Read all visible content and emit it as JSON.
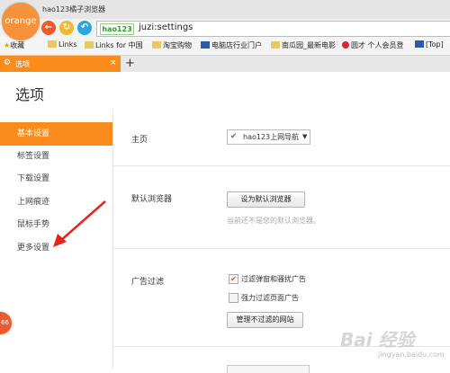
{
  "window": {
    "title": "hao123橘子浏览器",
    "logo_text": "orange"
  },
  "nav": {
    "back": "←",
    "refresh": "↻",
    "home": "↶"
  },
  "address": {
    "logo": "hao123",
    "url": "juzi:settings"
  },
  "bookmarks": [
    "收藏",
    "Links",
    "Links for 中国",
    "淘宝购物",
    "电脑店行业门户",
    "南瓜园_最新电影",
    "圆才 个人会员登",
    "[Top]"
  ],
  "tab": {
    "label": "选项",
    "close": "×",
    "new": "+"
  },
  "page": {
    "title": "选项"
  },
  "sidebar": {
    "items": [
      {
        "label": "基本设置",
        "active": true
      },
      {
        "label": "标签设置",
        "active": false
      },
      {
        "label": "下载设置",
        "active": false
      },
      {
        "label": "上网痕迹",
        "active": false
      },
      {
        "label": "鼠标手势",
        "active": false
      },
      {
        "label": "更多设置",
        "active": false
      }
    ]
  },
  "content": {
    "homepage": {
      "label": "主页",
      "select_value": "hao123上网导航"
    },
    "default_browser": {
      "label": "默认浏览器",
      "button": "设为默认浏览器",
      "hint": "当前还不是您的默认浏览器。"
    },
    "adblock": {
      "label": "广告过滤",
      "options": [
        {
          "label": "过滤弹窗和骚扰广告",
          "checked": true
        },
        {
          "label": "强力过滤页面广告",
          "checked": false
        }
      ],
      "button": "管理不过滤的网站"
    }
  },
  "overlay": {
    "badge": "66",
    "watermark": "Bai 经验",
    "watermark_sub": "jingyan.baidu.com"
  },
  "colors": {
    "accent": "#fa8c1d",
    "logo": "#f7913a",
    "arrow": "#e8231b"
  }
}
